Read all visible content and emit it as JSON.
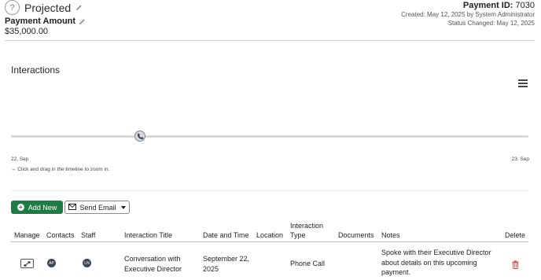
{
  "header": {
    "status": "Projected",
    "amount_label": "Payment Amount",
    "amount_value": "$35,000.00",
    "payment_id_label": "Payment ID:",
    "payment_id_value": "7030",
    "created": "Created: May 12, 2025 by System Administrator",
    "status_changed": "Status Changed: May 12, 2025"
  },
  "interactions": {
    "title": "Interactions",
    "timeline_start": "22. Sep",
    "timeline_end": "23. Sep",
    "hint": "↔ Click and drag in the timeline to zoom in."
  },
  "actions": {
    "add_new": "Add New",
    "send_email": "Send Email"
  },
  "table": {
    "headers": {
      "manage": "Manage",
      "contacts": "Contacts",
      "staff": "Staff",
      "title": "Interaction Title",
      "datetime": "Date and Time",
      "location": "Location",
      "type_line1": "Interaction",
      "type_line2": "Type",
      "documents": "Documents",
      "notes": "Notes",
      "delete": "Delete"
    },
    "rows": [
      {
        "contact_initials": "AP",
        "staff_initials": "LN",
        "title_line1": "Conversation with",
        "title_line2": "Executive Director",
        "date_line1": "September 22,",
        "date_line2": "2025",
        "location": "",
        "type": "Phone Call",
        "documents": "",
        "notes_line1": "Spoke with their Executive Director",
        "notes_line2": "about details on this upcoming",
        "notes_line3": "payment."
      }
    ]
  },
  "colors": {
    "primary_green": "#1f7a43",
    "delete_red": "#d9534f",
    "avatar_bg": "#3b4756"
  },
  "icons": {
    "status": "question-circle-icon",
    "edit": "pencil-icon",
    "menu": "hamburger-menu-icon",
    "timeline_marker": "phone-icon",
    "add": "plus-circle-icon",
    "email": "envelope-icon",
    "manage": "expand-icon",
    "delete": "trash-icon"
  }
}
